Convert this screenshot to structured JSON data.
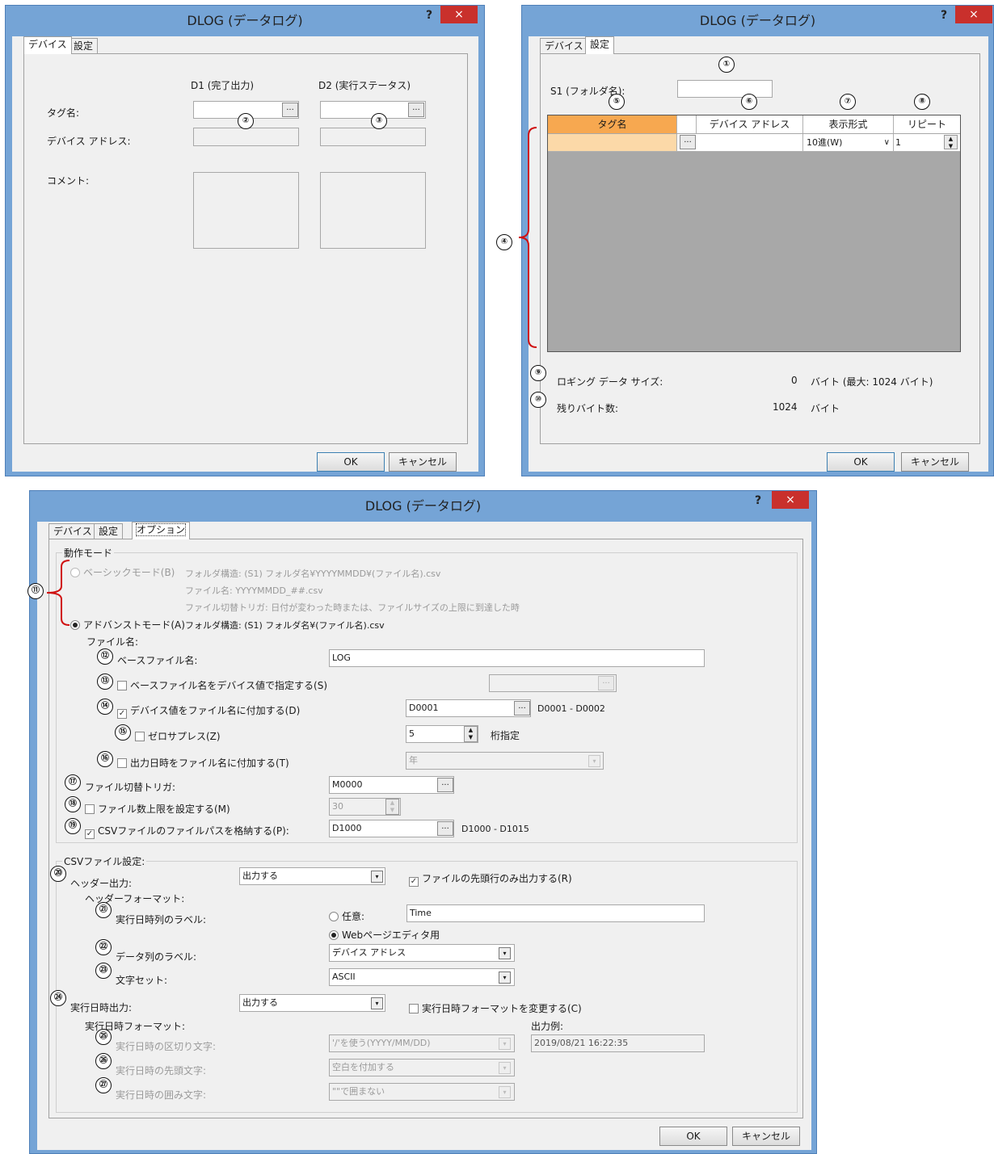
{
  "dialog_title": "DLOG (データログ)",
  "help": "?",
  "close": "×",
  "tabs": {
    "device": "デバイス",
    "settings": "設定",
    "options": "オプション"
  },
  "buttons": {
    "ok": "OK",
    "cancel": "キャンセル"
  },
  "device_tab": {
    "col_d1": "D1 (完了出力)",
    "col_d2": "D2 (実行ステータス)",
    "tag_label": "タグ名:",
    "address_label": "デバイス アドレス:",
    "comment_label": "コメント:",
    "ellipsis": "..."
  },
  "settings_tab": {
    "s1_label": "S1 (フォルダ名):",
    "s1_value": "",
    "headers": {
      "tag": "タグ名",
      "address": "デバイス アドレス",
      "format": "表示形式",
      "repeat": "リピート"
    },
    "row": {
      "tag": "",
      "address": "",
      "format": "10進(W)",
      "repeat": "1"
    },
    "logging_size_label": "ロギング データ サイズ:",
    "logging_size_value": "0",
    "logging_size_unit": "バイト (最大: 1024 バイト)",
    "remaining_label": "残りバイト数:",
    "remaining_value": "1024",
    "remaining_unit": "バイト"
  },
  "options_tab": {
    "mode_group": "動作モード",
    "basic_mode": "ベーシックモード(B)",
    "basic_desc1": "フォルダ構造: (S1) フォルダ名¥YYYYMMDD¥(ファイル名).csv",
    "basic_desc2": "ファイル名: YYYYMMDD_##.csv",
    "basic_desc3": "ファイル切替トリガ: 日付が変わった時または、ファイルサイズの上限に到達した時",
    "advanced_mode": "アドバンストモード(A)",
    "advanced_desc": "フォルダ構造: (S1) フォルダ名¥(ファイル名).csv",
    "file_name_heading": "ファイル名:",
    "base_file_label": "ベースファイル名:",
    "base_file_value": "LOG",
    "base_by_device": "ベースファイル名をデバイス値で指定する(S)",
    "append_device": "デバイス値をファイル名に付加する(D)",
    "append_device_value": "D0001",
    "append_device_range": "D0001 - D0002",
    "zero_suppress": "ゼロサプレス(Z)",
    "digits_value": "5",
    "digits_label": "桁指定",
    "append_datetime": "出力日時をファイル名に付加する(T)",
    "datetime_select": "年",
    "trigger_label": "ファイル切替トリガ:",
    "trigger_value": "M0000",
    "limit_label": "ファイル数上限を設定する(M)",
    "limit_value": "30",
    "store_path_label": "CSVファイルのファイルパスを格納する(P):",
    "store_path_value": "D1000",
    "store_path_range": "D1000 - D1015",
    "csv_group": "CSVファイル設定:",
    "header_output_label": "ヘッダー出力:",
    "header_output_value": "出力する",
    "first_row_only": "ファイルの先頭行のみ出力する(R)",
    "header_format_heading": "ヘッダーフォーマット:",
    "datetime_col_label": "実行日時列のラベル:",
    "any_label": "任意:",
    "any_value": "Time",
    "web_editor": "Webページエディタ用",
    "data_col_label": "データ列のラベル:",
    "data_col_value": "デバイス アドレス",
    "charset_label": "文字セット:",
    "charset_value": "ASCII",
    "exec_output_label": "実行日時出力:",
    "exec_output_value": "出力する",
    "change_format": "実行日時フォーマットを変更する(C)",
    "exec_format_heading": "実行日時フォーマット:",
    "output_example_label": "出力例:",
    "output_example_value": "2019/08/21 16:22:35",
    "separator_label": "実行日時の区切り文字:",
    "separator_value": "'/'を使う(YYYY/MM/DD)",
    "prefix_label": "実行日時の先頭文字:",
    "prefix_value": "空白を付加する",
    "enclose_label": "実行日時の囲み文字:",
    "enclose_value": "\"\"で囲まない"
  },
  "callouts": [
    "①",
    "②",
    "③",
    "④",
    "⑤",
    "⑥",
    "⑦",
    "⑧",
    "⑨",
    "⑩",
    "⑪",
    "⑫",
    "⑬",
    "⑭",
    "⑮",
    "⑯",
    "⑰",
    "⑱",
    "⑲",
    "⑳",
    "㉑",
    "㉒",
    "㉓",
    "㉔",
    "㉕",
    "㉖",
    "㉗"
  ],
  "colors": {
    "title_bar": "#75a4d6",
    "close": "#c9302c",
    "header_highlight": "#f7a850",
    "row_highlight": "#fcd9a8",
    "grid_bg": "#a8a8a8",
    "callout_bracket": "#d01010"
  }
}
